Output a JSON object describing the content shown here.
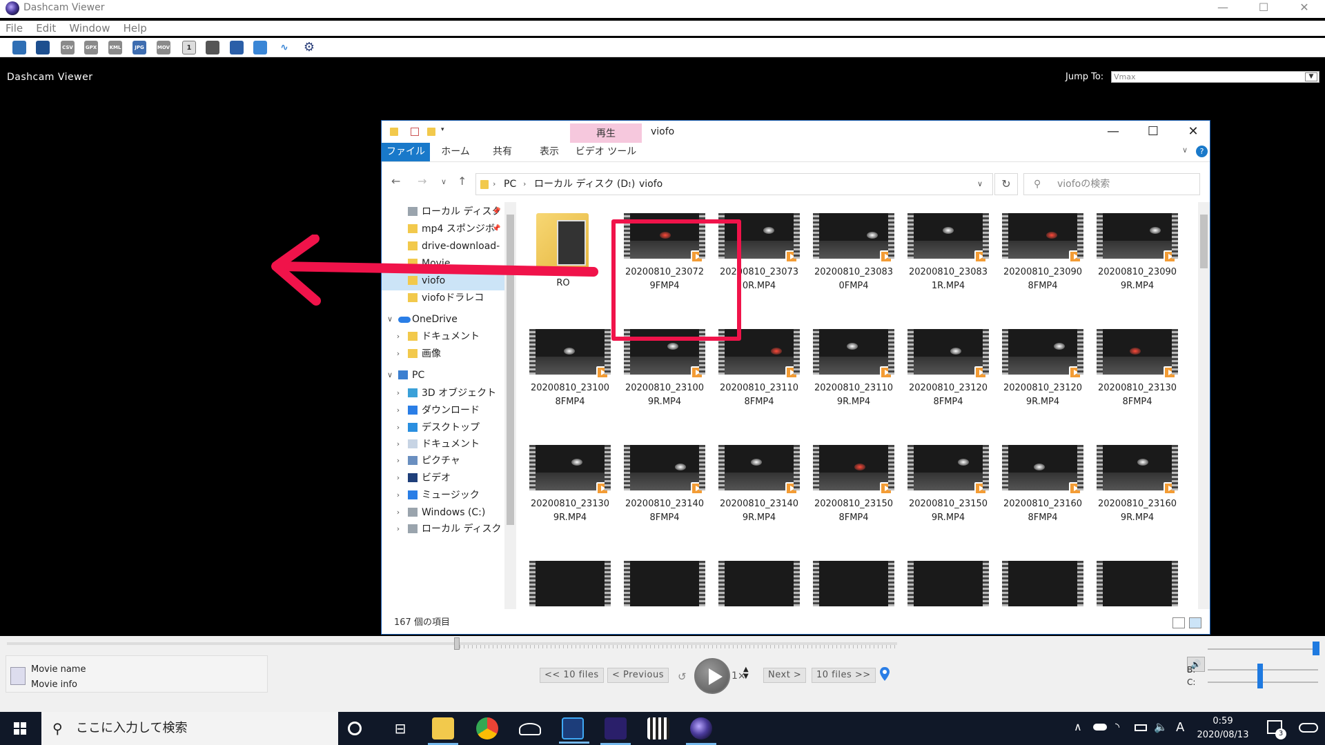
{
  "app": {
    "title": "Dashcam Viewer",
    "menu": [
      "File",
      "Edit",
      "Window",
      "Help"
    ],
    "window_controls": [
      "—",
      "☐",
      "✕"
    ],
    "toolbar_icons": [
      {
        "name": "open-folder-icon",
        "label": ""
      },
      {
        "name": "multi-file-icon",
        "label": ""
      },
      {
        "name": "export-csv-icon",
        "label": "CSV"
      },
      {
        "name": "export-gpx-icon",
        "label": "GPX"
      },
      {
        "name": "export-kml-icon",
        "label": "KML"
      },
      {
        "name": "export-jpg-icon",
        "label": "JPG"
      },
      {
        "name": "export-mov-icon",
        "label": "MOV"
      },
      {
        "name": "single-view-icon",
        "label": "1"
      },
      {
        "name": "trim-icon",
        "label": ""
      },
      {
        "name": "save-icon",
        "label": ""
      },
      {
        "name": "fullscreen-icon",
        "label": ""
      },
      {
        "name": "audio-wave-icon",
        "label": ""
      },
      {
        "name": "settings-gear-icon",
        "label": ""
      }
    ],
    "header_title": "Dashcam Viewer",
    "jump_to": {
      "label": "Jump To:",
      "value": "Vmax"
    }
  },
  "explorer": {
    "title": "viofo",
    "context_tab_header": "再生",
    "ribbon_tabs": [
      "ファイル",
      "ホーム",
      "共有",
      "表示",
      "ビデオ ツール"
    ],
    "breadcrumb": [
      "PC",
      "ローカル ディスク (D:)",
      "viofo"
    ],
    "search_placeholder": "viofoの検索",
    "status": "167 個の項目",
    "nav_items": [
      {
        "label": "ローカル ディスク",
        "pinned": true,
        "type": "drive"
      },
      {
        "label": "mp4 スポンジボ",
        "pinned": true,
        "type": "folder"
      },
      {
        "label": "drive-download-",
        "type": "folder"
      },
      {
        "label": "Movie",
        "type": "folder"
      },
      {
        "label": "viofo",
        "type": "folder",
        "selected": true
      },
      {
        "label": "viofoドラレコ",
        "type": "folder"
      },
      {
        "label": "OneDrive",
        "type": "onedrive",
        "expanded": true
      },
      {
        "label": "ドキュメント",
        "type": "folder",
        "child": true
      },
      {
        "label": "画像",
        "type": "folder",
        "child": true
      },
      {
        "label": "PC",
        "type": "pc",
        "expanded": true
      },
      {
        "label": "3D オブジェクト",
        "type": "3d",
        "child": true
      },
      {
        "label": "ダウンロード",
        "type": "download",
        "child": true
      },
      {
        "label": "デスクトップ",
        "type": "desktop",
        "child": true
      },
      {
        "label": "ドキュメント",
        "type": "doc",
        "child": true
      },
      {
        "label": "ピクチャ",
        "type": "picture",
        "child": true
      },
      {
        "label": "ビデオ",
        "type": "video",
        "child": true
      },
      {
        "label": "ミュージック",
        "type": "music",
        "child": true
      },
      {
        "label": "Windows (C:)",
        "type": "drive",
        "child": true
      },
      {
        "label": "ローカル ディスク (D",
        "type": "drive",
        "child": true
      }
    ],
    "files": [
      {
        "name": "RO",
        "kind": "folder"
      },
      {
        "name": "20200810_230729FMP4",
        "kind": "video",
        "line1": "20200810_23072",
        "line2": "9FMP4"
      },
      {
        "name": "20200810_230730R.MP4",
        "kind": "video",
        "line1": "20200810_23073",
        "line2": "0R.MP4"
      },
      {
        "name": "20200810_230830FMP4",
        "kind": "video",
        "line1": "20200810_23083",
        "line2": "0FMP4"
      },
      {
        "name": "20200810_230831R.MP4",
        "kind": "video",
        "line1": "20200810_23083",
        "line2": "1R.MP4"
      },
      {
        "name": "20200810_230908FMP4",
        "kind": "video",
        "line1": "20200810_23090",
        "line2": "8FMP4"
      },
      {
        "name": "20200810_230909R.MP4",
        "kind": "video",
        "line1": "20200810_23090",
        "line2": "9R.MP4"
      },
      {
        "name": "20200810_231008FMP4",
        "kind": "video",
        "line1": "20200810_23100",
        "line2": "8FMP4"
      },
      {
        "name": "20200810_231009R.MP4",
        "kind": "video",
        "line1": "20200810_23100",
        "line2": "9R.MP4"
      },
      {
        "name": "20200810_231108FMP4",
        "kind": "video",
        "line1": "20200810_23110",
        "line2": "8FMP4"
      },
      {
        "name": "20200810_231109R.MP4",
        "kind": "video",
        "line1": "20200810_23110",
        "line2": "9R.MP4"
      },
      {
        "name": "20200810_231208FMP4",
        "kind": "video",
        "line1": "20200810_23120",
        "line2": "8FMP4"
      },
      {
        "name": "20200810_231209R.MP4",
        "kind": "video",
        "line1": "20200810_23120",
        "line2": "9R.MP4"
      },
      {
        "name": "20200810_231308FMP4",
        "kind": "video",
        "line1": "20200810_23130",
        "line2": "8FMP4"
      },
      {
        "name": "20200810_231309R.MP4",
        "kind": "video",
        "line1": "20200810_23130",
        "line2": "9R.MP4"
      },
      {
        "name": "20200810_231408FMP4",
        "kind": "video",
        "line1": "20200810_23140",
        "line2": "8FMP4"
      },
      {
        "name": "20200810_231409R.MP4",
        "kind": "video",
        "line1": "20200810_23140",
        "line2": "9R.MP4"
      },
      {
        "name": "20200810_231508FMP4",
        "kind": "video",
        "line1": "20200810_23150",
        "line2": "8FMP4"
      },
      {
        "name": "20200810_231509R.MP4",
        "kind": "video",
        "line1": "20200810_23150",
        "line2": "9R.MP4"
      },
      {
        "name": "20200810_231608FMP4",
        "kind": "video",
        "line1": "20200810_23160",
        "line2": "8FMP4"
      },
      {
        "name": "20200810_231609R.MP4",
        "kind": "video",
        "line1": "20200810_23160",
        "line2": "9R.MP4"
      }
    ]
  },
  "player": {
    "movie_name_label": "Movie name",
    "movie_info_label": "Movie info",
    "prev10": "<< 10 files",
    "previous": "< Previous",
    "speed": "1×",
    "next": "Next >",
    "next10": "10 files >>",
    "balance_b": "B:",
    "balance_c": "C:"
  },
  "taskbar": {
    "search_placeholder": "ここに入力して検索",
    "time": "0:59",
    "date": "2020/08/13",
    "notification_count": "3",
    "ime": "A",
    "apps": [
      "task-view-icon",
      "file-explorer-icon",
      "chrome-icon",
      "cloud-app-icon",
      "video-editor-icon",
      "waveform-app-icon",
      "clapper-app-icon",
      "dashcam-viewer-icon"
    ]
  },
  "colors": {
    "accent_blue": "#1979ca",
    "annotation_red": "#f0134a",
    "context_pink": "#f6c8dd",
    "taskbar": "#101828"
  }
}
